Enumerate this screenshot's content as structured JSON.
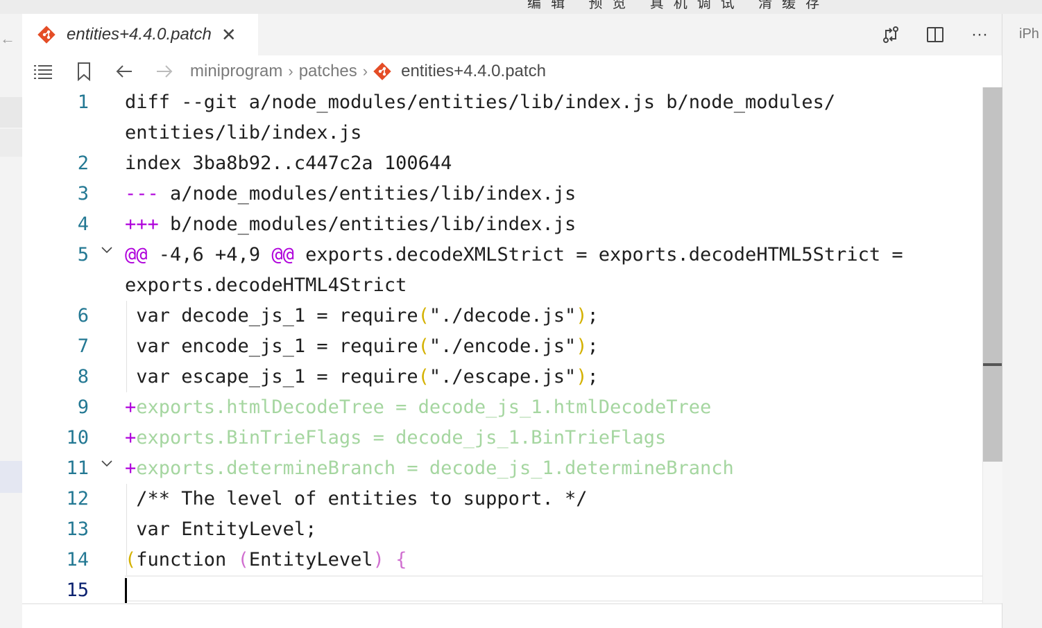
{
  "window": {
    "top_title_fragment": "编辑 预览 真机调试 清缓存"
  },
  "tab": {
    "title": "entities+4.4.0.patch",
    "git_icon": "git-icon",
    "close_icon": "close-icon"
  },
  "tab_actions": [
    "compare-changes-icon",
    "split-editor-icon",
    "more-actions-icon"
  ],
  "right_pane": {
    "partial_label": "iPh"
  },
  "breadcrumb": {
    "items": [
      "miniprogram",
      "patches",
      "entities+4.4.0.patch"
    ]
  },
  "toolbar_icons": [
    "outline-list-icon",
    "bookmark-icon",
    "back-arrow-icon",
    "forward-arrow-icon"
  ],
  "editor": {
    "current_line": 15,
    "lines": [
      {
        "num": "1",
        "text": "diff --git a/node_modules/entities/lib/index.js b/node_modules/"
      },
      {
        "num": "",
        "text": "entities/lib/index.js"
      },
      {
        "num": "2",
        "text": "index 3ba8b92..c447c2a 100644"
      },
      {
        "num": "3",
        "prefix": "---",
        "text": " a/node_modules/entities/lib/index.js"
      },
      {
        "num": "4",
        "prefix": "+++",
        "text": " b/node_modules/entities/lib/index.js"
      },
      {
        "num": "5",
        "hunk_a": "@@",
        "hunk_range": " -4,6 +4,9 ",
        "hunk_b": "@@",
        "text": " exports.decodeXMLStrict = exports.decodeHTML5Strict ="
      },
      {
        "num": "",
        "text": "exports.decodeHTML4Strict"
      },
      {
        "num": "6",
        "pre": " var decode_js_1 = require",
        "open": "(",
        "str": "\"./decode.js\"",
        "close": ")",
        "post": ";"
      },
      {
        "num": "7",
        "pre": " var encode_js_1 = require",
        "open": "(",
        "str": "\"./encode.js\"",
        "close": ")",
        "post": ";"
      },
      {
        "num": "8",
        "pre": " var escape_js_1 = require",
        "open": "(",
        "str": "\"./escape.js\"",
        "close": ")",
        "post": ";"
      },
      {
        "num": "9",
        "plus": "+",
        "text": "exports.htmlDecodeTree = decode_js_1.htmlDecodeTree"
      },
      {
        "num": "10",
        "plus": "+",
        "text": "exports.BinTrieFlags = decode_js_1.BinTrieFlags"
      },
      {
        "num": "11",
        "plus": "+",
        "text": "exports.determineBranch = decode_js_1.determineBranch"
      },
      {
        "num": "12",
        "text": " /** The level of entities to support. */"
      },
      {
        "num": "13",
        "text": " var EntityLevel;"
      },
      {
        "num": "14",
        "open1": "(",
        "mid": "function ",
        "open2": "(",
        "arg": "EntityLevel",
        "close2": ")",
        "sp": " ",
        "brace": "{"
      },
      {
        "num": "15",
        "text": ""
      }
    ]
  }
}
